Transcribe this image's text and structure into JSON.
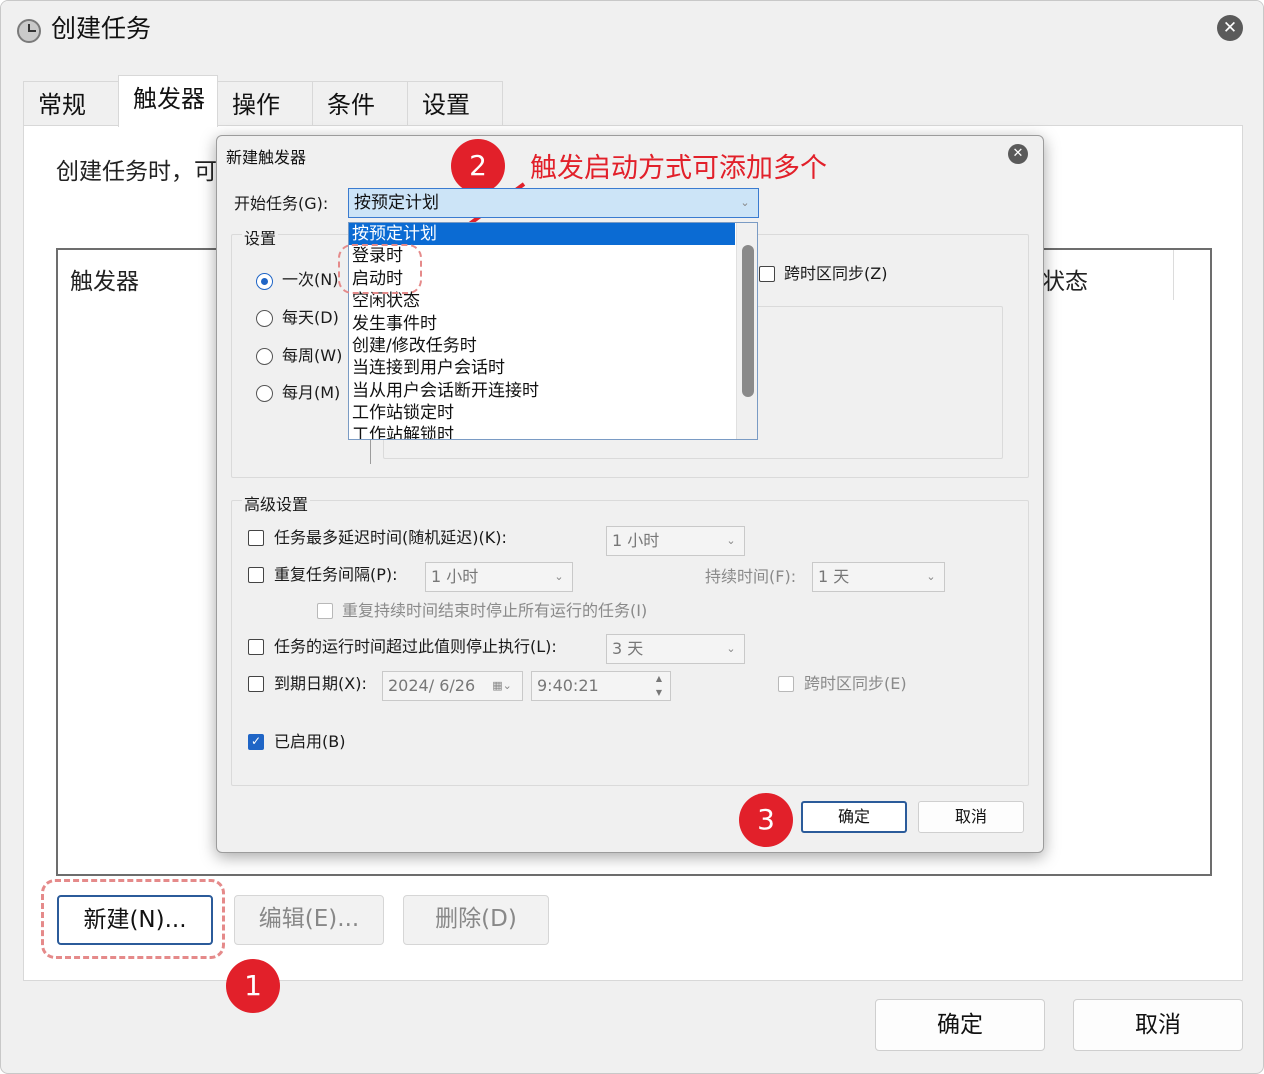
{
  "window": {
    "title": "创建任务"
  },
  "tabs": [
    "常规",
    "触发器",
    "操作",
    "条件",
    "设置"
  ],
  "panel": {
    "description": "创建任务时，可",
    "list_columns": {
      "trigger": "触发器",
      "status": "状态"
    },
    "buttons": {
      "new": "新建(N)...",
      "edit": "编辑(E)...",
      "delete": "删除(D)"
    }
  },
  "footer": {
    "ok": "确定",
    "cancel": "取消"
  },
  "annotations": {
    "badge1": "1",
    "badge2": "2",
    "badge3": "3",
    "note": "触发启动方式可添加多个"
  },
  "dialog": {
    "title": "新建触发器",
    "start_task_label": "开始任务(G):",
    "start_task_value": "按预定计划",
    "dropdown_options": [
      "按预定计划",
      "登录时",
      "启动时",
      "空闲状态",
      "发生事件时",
      "创建/修改任务时",
      "当连接到用户会话时",
      "当从用户会话断开连接时",
      "工作站锁定时",
      "工作站解锁时"
    ],
    "settings_label": "设置",
    "schedule_options": [
      "一次(N)",
      "每天(D)",
      "每周(W)",
      "每月(M)"
    ],
    "sync_timezone": "跨时区同步(Z)",
    "advanced_label": "高级设置",
    "delay_label": "任务最多延迟时间(随机延迟)(K):",
    "delay_value": "1 小时",
    "repeat_label": "重复任务间隔(P):",
    "repeat_value": "1 小时",
    "duration_label": "持续时间(F):",
    "duration_value": "1 天",
    "stop_repeat_label": "重复持续时间结束时停止所有运行的任务(I)",
    "stop_if_runs_label": "任务的运行时间超过此值则停止执行(L):",
    "stop_if_runs_value": "3 天",
    "expire_label": "到期日期(X):",
    "expire_date": "2024/  6/26",
    "expire_time": "9:40:21",
    "expire_sync": "跨时区同步(E)",
    "enabled_label": "已启用(B)",
    "ok": "确定",
    "cancel": "取消"
  }
}
